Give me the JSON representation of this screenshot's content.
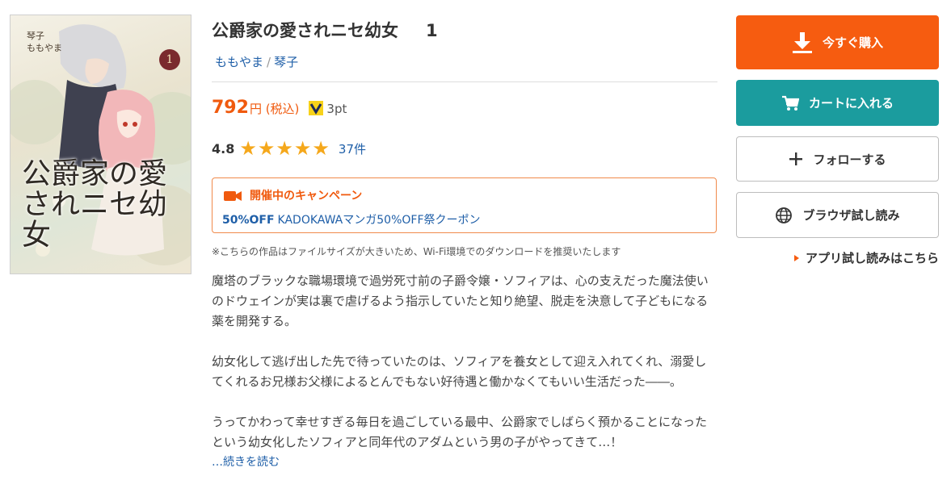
{
  "cover": {
    "author_line1": "琴子",
    "author_line2": "ももやま",
    "volume_badge": "1",
    "title_text": "公爵家の愛されニセ幼女"
  },
  "book": {
    "title": "公爵家の愛されニセ幼女",
    "volume": "1",
    "authors": [
      "ももやま",
      "琴子"
    ],
    "author_separator": "/"
  },
  "price": {
    "amount": "792",
    "unit": "円 (税込)",
    "points": "3pt",
    "point_icon": "v-point-icon"
  },
  "rating": {
    "value": "4.8",
    "stars": 5,
    "reviews": "37件"
  },
  "campaign": {
    "heading": "開催中のキャンペーン",
    "discount": "50%OFF",
    "name": "KADOKAWAマンガ50%OFF祭クーポン"
  },
  "note": "※こちらの作品はファイルサイズが大きいため、Wi-Fi環境でのダウンロードを推奨いたします",
  "description": {
    "p1": "魔塔のブラックな職場環境で過労死寸前の子爵令嬢・ソフィアは、心の支えだった魔法使いのドウェインが実は裏で虐げるよう指示していたと知り絶望、脱走を決意して子どもになる薬を開発する。",
    "p2": "幼女化して逃げ出した先で待っていたのは、ソフィアを養女として迎え入れてくれ、溺愛してくれるお兄様お父様によるとんでもない好待遇と働かなくてもいい生活だった――。",
    "p3": "うってかわって幸せすぎる毎日を過ごしている最中、公爵家でしばらく預かることになったという幼女化したソフィアと同年代のアダムという男の子がやってきて…！",
    "more": "…続きを読む"
  },
  "actions": {
    "buy": "今すぐ購入",
    "cart": "カートに入れる",
    "follow": "フォローする",
    "browse": "ブラウザ試し読み",
    "app": "アプリ試し読みはこちら"
  },
  "colors": {
    "accent_orange": "#f65c10",
    "cart_teal": "#1b9c9e",
    "link_blue": "#1f5fa8",
    "star_gold": "#f5a81c"
  }
}
